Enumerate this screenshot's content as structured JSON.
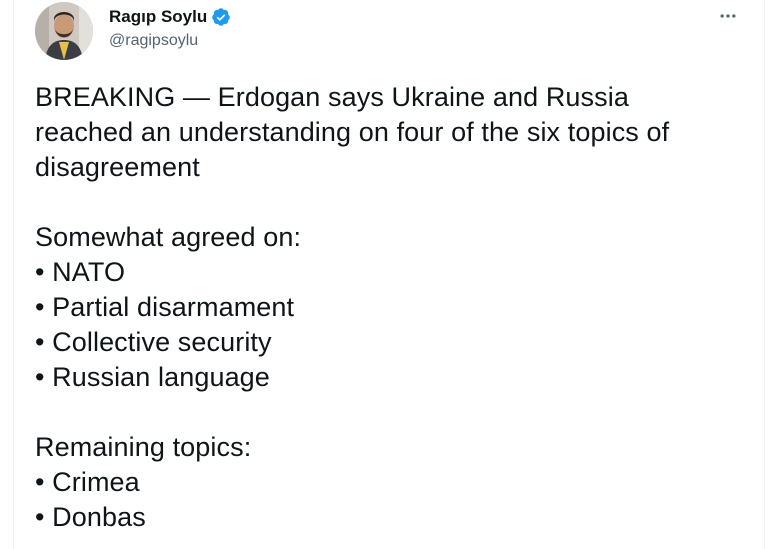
{
  "author": {
    "name": "Ragıp Soylu",
    "handle": "@ragipsoylu",
    "verified": true,
    "verified_color": "#1d9bf0"
  },
  "tweet": {
    "headline_lines": [
      "BREAKING — Erdogan says Ukraine and Russia",
      "reached an understanding on four of the six topics of",
      "disagreement"
    ],
    "agreed_heading": "Somewhat agreed on:",
    "agreed_items": [
      "NATO",
      "Partial disarmament",
      "Collective security",
      "Russian language"
    ],
    "remaining_heading": "Remaining topics:",
    "remaining_items": [
      "Crimea",
      "Donbas"
    ]
  },
  "icons": {
    "more": "more-horizontal-icon",
    "verified": "verified-badge-icon"
  }
}
